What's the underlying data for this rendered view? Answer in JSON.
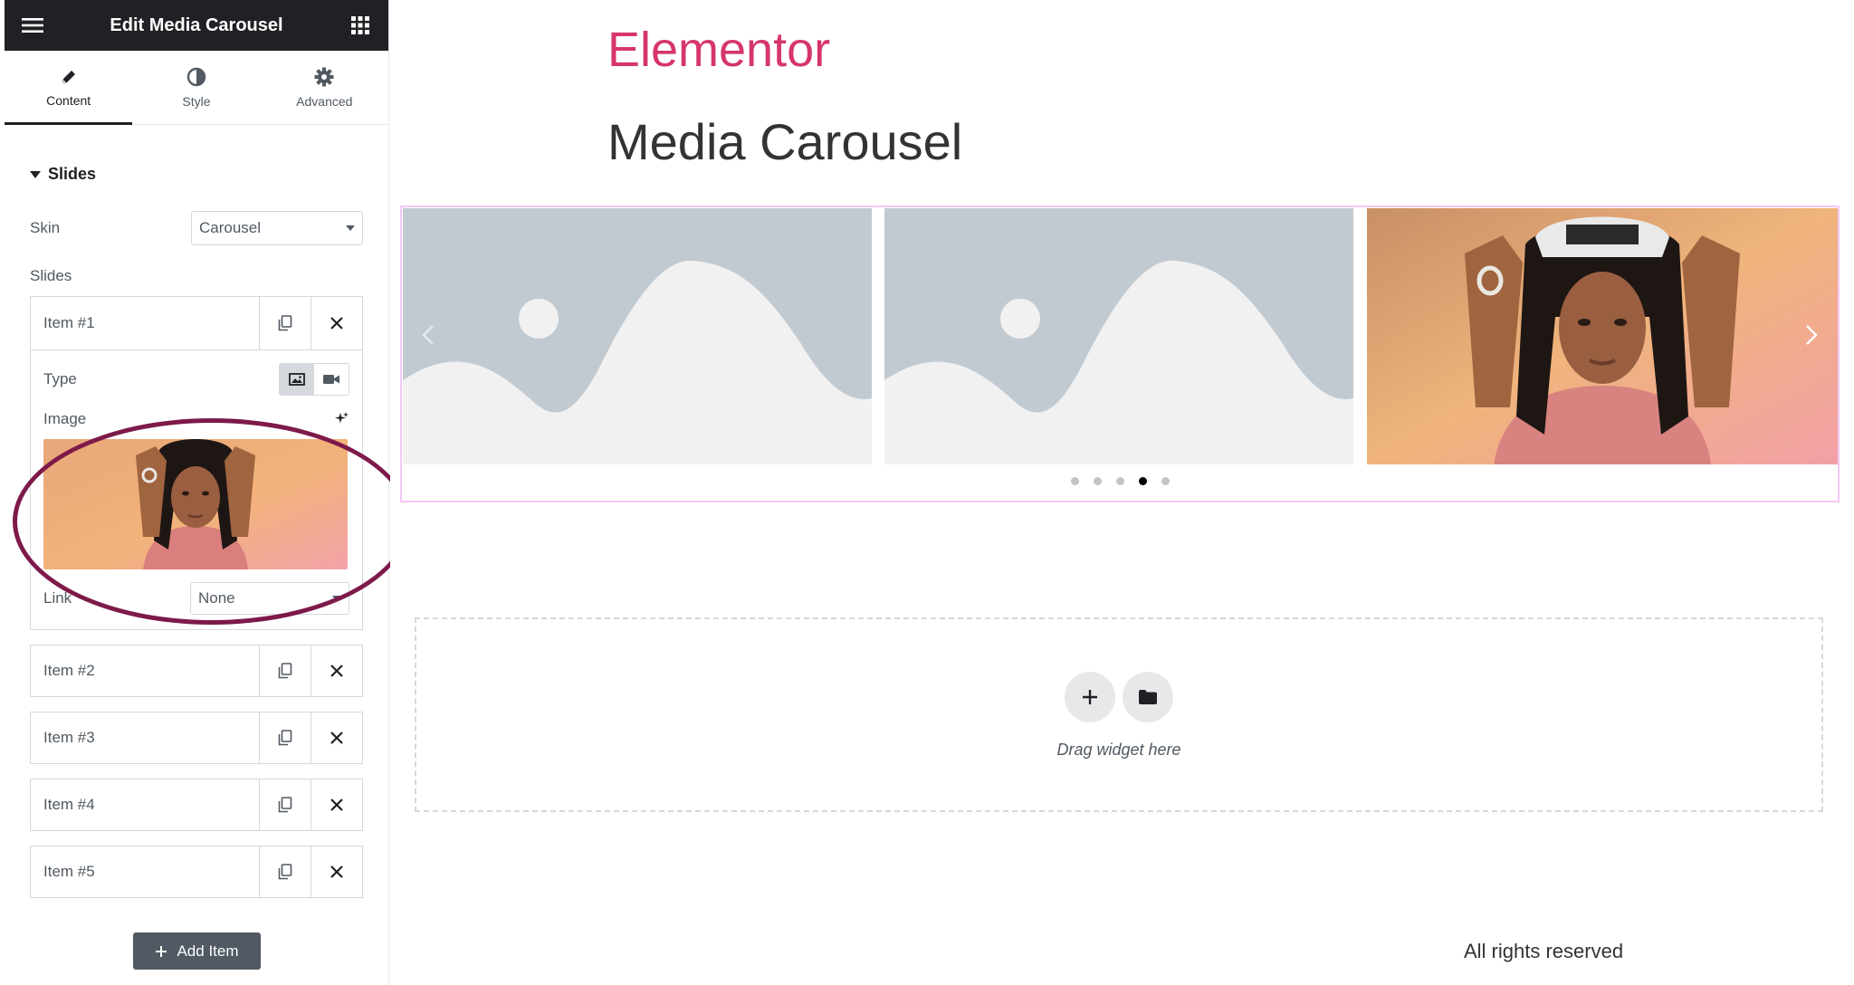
{
  "editor": {
    "title": "Edit Media Carousel",
    "tabs": [
      {
        "label": "Content",
        "active": true
      },
      {
        "label": "Style",
        "active": false
      },
      {
        "label": "Advanced",
        "active": false
      }
    ],
    "section_title": "Slides",
    "skin": {
      "label": "Skin",
      "value": "Carousel"
    },
    "slides_label": "Slides",
    "items": [
      {
        "label": "Item #1",
        "expanded": true
      },
      {
        "label": "Item #2",
        "expanded": false
      },
      {
        "label": "Item #3",
        "expanded": false
      },
      {
        "label": "Item #4",
        "expanded": false
      },
      {
        "label": "Item #5",
        "expanded": false
      }
    ],
    "item_fields": {
      "type_label": "Type",
      "image_label": "Image",
      "link_label": "Link",
      "link_value": "None"
    },
    "add_item_label": "Add Item"
  },
  "canvas": {
    "brand": "Elementor",
    "page_title": "Media Carousel",
    "carousel": {
      "slide_count": 5,
      "active_dot": 4
    },
    "dropzone_text": "Drag widget here",
    "footer_text": "All rights reserved"
  },
  "colors": {
    "brand": "#d63669",
    "topbar": "#1f2124",
    "highlight": "#7d1a4a",
    "widget_outline": "#f1c9f4",
    "placeholder_bg": "#c2cad1",
    "placeholder_fg": "#f1f1f2"
  }
}
